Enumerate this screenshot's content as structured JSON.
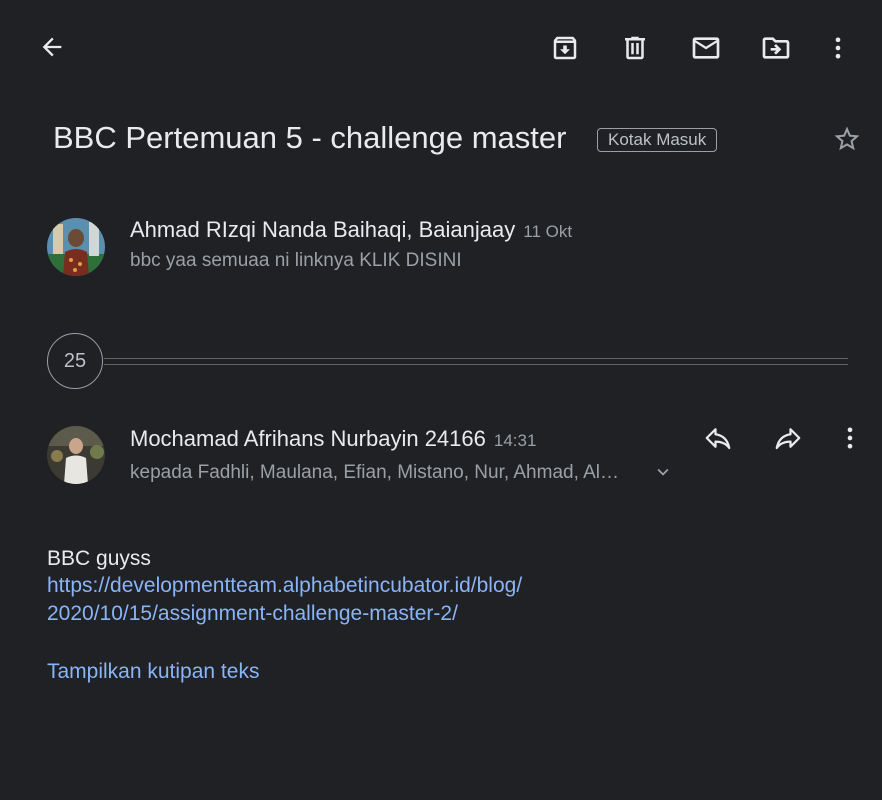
{
  "toolbar": {
    "back": "back-arrow-icon",
    "actions": [
      "archive-icon",
      "delete-icon",
      "mark-unread-icon",
      "move-to-icon",
      "more-vert-icon"
    ]
  },
  "subject": "BBC Pertemuan 5 - challenge master",
  "label": "Kotak Masuk",
  "messages": [
    {
      "sender": "Ahmad RIzqi Nanda Baihaqi, Baianjaay",
      "time": "11 Okt",
      "snippet": "bbc yaa semuaa ni linknya KLIK DISINI"
    }
  ],
  "collapsed_count": "25",
  "latest": {
    "sender": "Mochamad Afrihans Nurbayin 24166",
    "time": "14:31",
    "recipients": "kepada Fadhli, Maulana, Efian, Mistano, Nur, Ahmad, Al…",
    "body": "BBC guyss",
    "link_line1": "https://developmentteam.alphabetincubator.id/blog/",
    "link_line2": "2020/10/15/assignment-challenge-master-2/",
    "show_quoted": "Tampilkan kutipan teks"
  },
  "colors": {
    "background": "#202124",
    "text": "#e8eaed",
    "secondary": "#9aa0a6",
    "link": "#8ab4f8"
  }
}
